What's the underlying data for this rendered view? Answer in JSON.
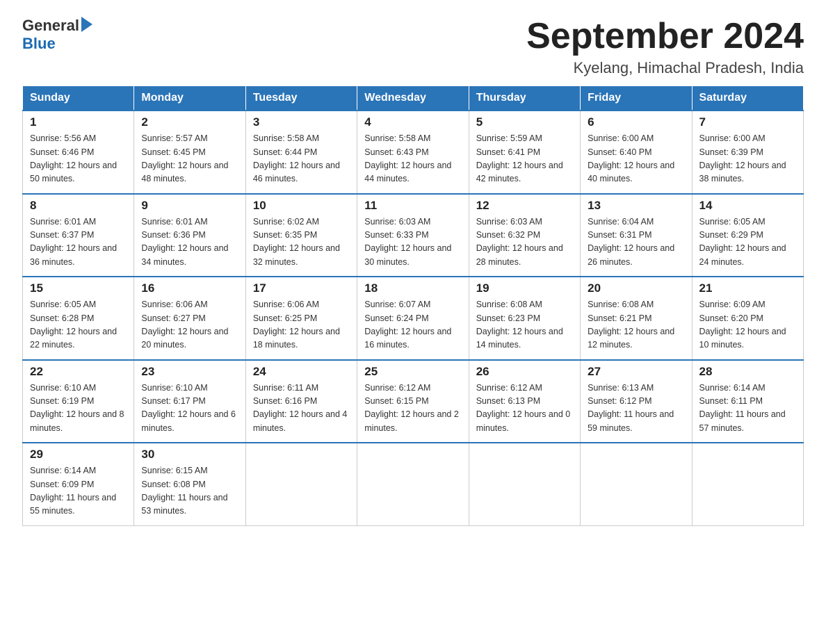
{
  "header": {
    "logo_general": "General",
    "logo_blue": "Blue",
    "month_title": "September 2024",
    "location": "Kyelang, Himachal Pradesh, India"
  },
  "weekdays": [
    "Sunday",
    "Monday",
    "Tuesday",
    "Wednesday",
    "Thursday",
    "Friday",
    "Saturday"
  ],
  "weeks": [
    [
      {
        "day": "1",
        "sunrise": "Sunrise: 5:56 AM",
        "sunset": "Sunset: 6:46 PM",
        "daylight": "Daylight: 12 hours and 50 minutes."
      },
      {
        "day": "2",
        "sunrise": "Sunrise: 5:57 AM",
        "sunset": "Sunset: 6:45 PM",
        "daylight": "Daylight: 12 hours and 48 minutes."
      },
      {
        "day": "3",
        "sunrise": "Sunrise: 5:58 AM",
        "sunset": "Sunset: 6:44 PM",
        "daylight": "Daylight: 12 hours and 46 minutes."
      },
      {
        "day": "4",
        "sunrise": "Sunrise: 5:58 AM",
        "sunset": "Sunset: 6:43 PM",
        "daylight": "Daylight: 12 hours and 44 minutes."
      },
      {
        "day": "5",
        "sunrise": "Sunrise: 5:59 AM",
        "sunset": "Sunset: 6:41 PM",
        "daylight": "Daylight: 12 hours and 42 minutes."
      },
      {
        "day": "6",
        "sunrise": "Sunrise: 6:00 AM",
        "sunset": "Sunset: 6:40 PM",
        "daylight": "Daylight: 12 hours and 40 minutes."
      },
      {
        "day": "7",
        "sunrise": "Sunrise: 6:00 AM",
        "sunset": "Sunset: 6:39 PM",
        "daylight": "Daylight: 12 hours and 38 minutes."
      }
    ],
    [
      {
        "day": "8",
        "sunrise": "Sunrise: 6:01 AM",
        "sunset": "Sunset: 6:37 PM",
        "daylight": "Daylight: 12 hours and 36 minutes."
      },
      {
        "day": "9",
        "sunrise": "Sunrise: 6:01 AM",
        "sunset": "Sunset: 6:36 PM",
        "daylight": "Daylight: 12 hours and 34 minutes."
      },
      {
        "day": "10",
        "sunrise": "Sunrise: 6:02 AM",
        "sunset": "Sunset: 6:35 PM",
        "daylight": "Daylight: 12 hours and 32 minutes."
      },
      {
        "day": "11",
        "sunrise": "Sunrise: 6:03 AM",
        "sunset": "Sunset: 6:33 PM",
        "daylight": "Daylight: 12 hours and 30 minutes."
      },
      {
        "day": "12",
        "sunrise": "Sunrise: 6:03 AM",
        "sunset": "Sunset: 6:32 PM",
        "daylight": "Daylight: 12 hours and 28 minutes."
      },
      {
        "day": "13",
        "sunrise": "Sunrise: 6:04 AM",
        "sunset": "Sunset: 6:31 PM",
        "daylight": "Daylight: 12 hours and 26 minutes."
      },
      {
        "day": "14",
        "sunrise": "Sunrise: 6:05 AM",
        "sunset": "Sunset: 6:29 PM",
        "daylight": "Daylight: 12 hours and 24 minutes."
      }
    ],
    [
      {
        "day": "15",
        "sunrise": "Sunrise: 6:05 AM",
        "sunset": "Sunset: 6:28 PM",
        "daylight": "Daylight: 12 hours and 22 minutes."
      },
      {
        "day": "16",
        "sunrise": "Sunrise: 6:06 AM",
        "sunset": "Sunset: 6:27 PM",
        "daylight": "Daylight: 12 hours and 20 minutes."
      },
      {
        "day": "17",
        "sunrise": "Sunrise: 6:06 AM",
        "sunset": "Sunset: 6:25 PM",
        "daylight": "Daylight: 12 hours and 18 minutes."
      },
      {
        "day": "18",
        "sunrise": "Sunrise: 6:07 AM",
        "sunset": "Sunset: 6:24 PM",
        "daylight": "Daylight: 12 hours and 16 minutes."
      },
      {
        "day": "19",
        "sunrise": "Sunrise: 6:08 AM",
        "sunset": "Sunset: 6:23 PM",
        "daylight": "Daylight: 12 hours and 14 minutes."
      },
      {
        "day": "20",
        "sunrise": "Sunrise: 6:08 AM",
        "sunset": "Sunset: 6:21 PM",
        "daylight": "Daylight: 12 hours and 12 minutes."
      },
      {
        "day": "21",
        "sunrise": "Sunrise: 6:09 AM",
        "sunset": "Sunset: 6:20 PM",
        "daylight": "Daylight: 12 hours and 10 minutes."
      }
    ],
    [
      {
        "day": "22",
        "sunrise": "Sunrise: 6:10 AM",
        "sunset": "Sunset: 6:19 PM",
        "daylight": "Daylight: 12 hours and 8 minutes."
      },
      {
        "day": "23",
        "sunrise": "Sunrise: 6:10 AM",
        "sunset": "Sunset: 6:17 PM",
        "daylight": "Daylight: 12 hours and 6 minutes."
      },
      {
        "day": "24",
        "sunrise": "Sunrise: 6:11 AM",
        "sunset": "Sunset: 6:16 PM",
        "daylight": "Daylight: 12 hours and 4 minutes."
      },
      {
        "day": "25",
        "sunrise": "Sunrise: 6:12 AM",
        "sunset": "Sunset: 6:15 PM",
        "daylight": "Daylight: 12 hours and 2 minutes."
      },
      {
        "day": "26",
        "sunrise": "Sunrise: 6:12 AM",
        "sunset": "Sunset: 6:13 PM",
        "daylight": "Daylight: 12 hours and 0 minutes."
      },
      {
        "day": "27",
        "sunrise": "Sunrise: 6:13 AM",
        "sunset": "Sunset: 6:12 PM",
        "daylight": "Daylight: 11 hours and 59 minutes."
      },
      {
        "day": "28",
        "sunrise": "Sunrise: 6:14 AM",
        "sunset": "Sunset: 6:11 PM",
        "daylight": "Daylight: 11 hours and 57 minutes."
      }
    ],
    [
      {
        "day": "29",
        "sunrise": "Sunrise: 6:14 AM",
        "sunset": "Sunset: 6:09 PM",
        "daylight": "Daylight: 11 hours and 55 minutes."
      },
      {
        "day": "30",
        "sunrise": "Sunrise: 6:15 AM",
        "sunset": "Sunset: 6:08 PM",
        "daylight": "Daylight: 11 hours and 53 minutes."
      },
      null,
      null,
      null,
      null,
      null
    ]
  ]
}
